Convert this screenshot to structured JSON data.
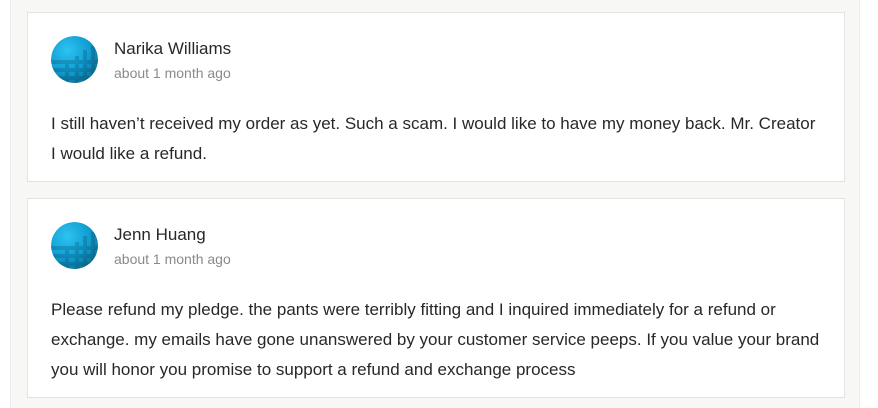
{
  "comments": [
    {
      "author": "Narika Williams",
      "time": "about 1 month ago",
      "body": "I still haven’t received my order as yet. Such a scam. I would like to have my money back. Mr. Creator I would like a refund."
    },
    {
      "author": "Jenn Huang",
      "time": "about 1 month ago",
      "body": "Please refund my pledge. the pants were terribly fitting and I inquired immediately for a refund or exchange. my emails have gone unanswered by your customer service peeps. If you value your brand you will honor you promise to support a refund and exchange process"
    }
  ],
  "colors": {
    "avatar_light": "#1aa7dd",
    "avatar_dark": "#0a6f94",
    "text": "#282828",
    "muted": "#8a8a8a",
    "panel_bg": "#f7f7f6",
    "card_border": "#e3e3e0"
  },
  "icons": {
    "avatar": "default-user-avatar-icon"
  }
}
